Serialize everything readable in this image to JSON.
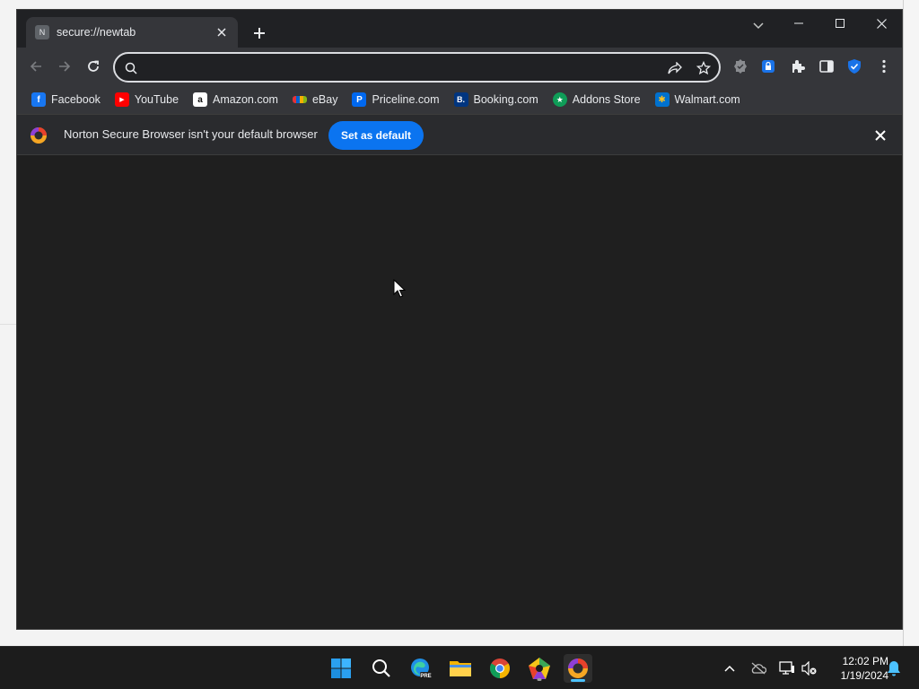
{
  "browser": {
    "tab": {
      "favicon_letter": "N",
      "title": "secure://newtab"
    },
    "omnibox": {
      "value": "",
      "placeholder": ""
    },
    "bookmarks": [
      {
        "label": "Facebook",
        "icon": "facebook-icon",
        "color": "#1877f2",
        "glyph": "f"
      },
      {
        "label": "YouTube",
        "icon": "youtube-icon",
        "color": "#ff0000",
        "glyph": "▶"
      },
      {
        "label": "Amazon.com",
        "icon": "amazon-icon",
        "color": "#ffffff",
        "glyph": "a"
      },
      {
        "label": "eBay",
        "icon": "ebay-icon",
        "color": "#e53238",
        "glyph": "e"
      },
      {
        "label": "Priceline.com",
        "icon": "priceline-icon",
        "color": "#0068ef",
        "glyph": "P"
      },
      {
        "label": "Booking.com",
        "icon": "booking-icon",
        "color": "#003580",
        "glyph": "B."
      },
      {
        "label": "Addons Store",
        "icon": "addons-store-icon",
        "color": "#0f9d58",
        "glyph": "★"
      },
      {
        "label": "Walmart.com",
        "icon": "walmart-icon",
        "color": "#0071ce",
        "glyph": "✱"
      }
    ],
    "infobar": {
      "message": "Norton Secure Browser isn't your default browser",
      "button_label": "Set as default",
      "button_color": "#0b74f0"
    }
  },
  "taskbar": {
    "time": "12:02 PM",
    "date": "1/19/2024",
    "apps": [
      "start-icon",
      "search-icon",
      "edge-preview-icon",
      "file-explorer-icon",
      "chrome-icon",
      "norton-vpn-icon",
      "norton-browser-icon"
    ]
  }
}
